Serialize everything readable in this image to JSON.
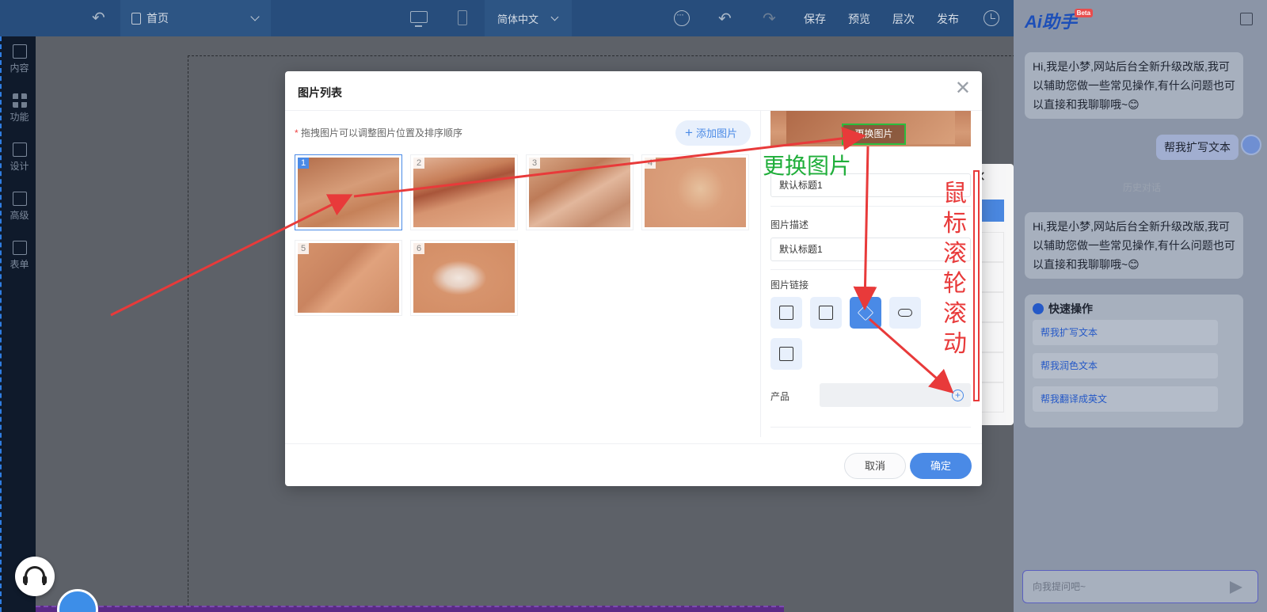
{
  "topbar": {
    "page_name": "首页",
    "language": "简体中文",
    "save": "保存",
    "preview": "预览",
    "layers": "层次",
    "publish": "发布"
  },
  "sidebar": {
    "items": [
      {
        "label": "内容"
      },
      {
        "label": "功能"
      },
      {
        "label": "设计"
      },
      {
        "label": "高级"
      },
      {
        "label": "表单"
      }
    ]
  },
  "modal": {
    "title": "图片列表",
    "hint": "拖拽图片可以调整图片位置及排序顺序",
    "add_image": "添加图片",
    "thumbnails": [
      "1",
      "2",
      "3",
      "4",
      "5",
      "6"
    ],
    "change_image": "更换图片",
    "title_value": "默认标题1",
    "desc_label": "图片描述",
    "desc_value": "默认标题1",
    "link_label": "图片链接",
    "product_label": "产品",
    "cancel": "取消",
    "confirm": "确定"
  },
  "annotations": {
    "change_image": "更换图片",
    "scroll_chars": [
      "鼠",
      "标",
      "滚",
      "轮",
      "滚",
      "动"
    ]
  },
  "ai": {
    "logo": "Ai助手",
    "beta": "Beta",
    "greeting_1": "Hi,我是小梦,网站后台全新升级改版,我可以辅助您做一些常见操作,有什么问题也可以直接和我聊聊哦~😊",
    "user_msg": "帮我扩写文本",
    "history_divider": "历史对话",
    "greeting_2": "Hi,我是小梦,网站后台全新升级改版,我可以辅助您做一些常见操作,有什么问题也可以直接和我聊聊哦~😊",
    "quick_title": "快速操作",
    "quick_actions": [
      "帮我扩写文本",
      "帮我润色文本",
      "帮我翻译成英文"
    ],
    "input_placeholder": "向我提问吧~"
  }
}
